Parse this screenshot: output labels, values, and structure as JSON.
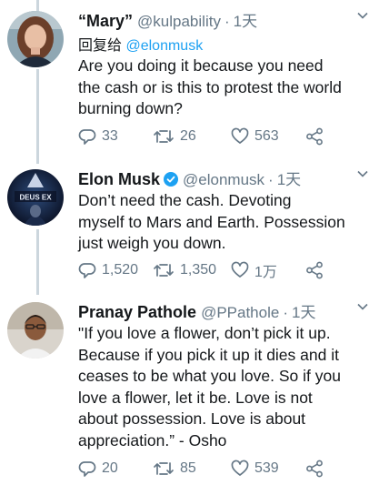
{
  "tweets": [
    {
      "name": "“Mary”",
      "handle": "@kulpability",
      "dot": "·",
      "time": "1天",
      "reply_prefix": "回复给",
      "reply_handle": "@elonmusk",
      "text_lines": [
        "Are you doing it because you need",
        "the cash or is this to protest the world",
        "burning down?"
      ],
      "replies": "33",
      "retweets": "26",
      "likes": "563"
    },
    {
      "name": "Elon Musk",
      "verified": true,
      "handle": "@elonmusk",
      "dot": "·",
      "time": "1天",
      "avatar_caption": "DEUS EX",
      "text_lines": [
        "Don’t need the cash. Devoting",
        "myself to Mars and Earth. Possession",
        "just weigh you down."
      ],
      "replies": "1,520",
      "retweets": "1,350",
      "likes": "1万"
    },
    {
      "name": "Pranay Pathole",
      "handle": "@PPathole",
      "dot": "·",
      "time": "1天",
      "text_lines": [
        "\"If you love a flower, don’t pick it up.",
        "Because if you pick it up it dies and it",
        "ceases to be what you love. So if you",
        "love a flower, let it be. Love is not",
        "about possession. Love is about",
        "appreciation.” - Osho"
      ],
      "replies": "20",
      "retweets": "85",
      "likes": "539"
    }
  ],
  "colors": {
    "link": "#1da1f2",
    "muted": "#657786",
    "thread_line": "#ccd6dd",
    "verified": "#1da1f2"
  },
  "icons": [
    "reply-icon",
    "retweet-icon",
    "like-icon",
    "share-icon",
    "chevron-down-icon",
    "verified-badge-icon"
  ]
}
